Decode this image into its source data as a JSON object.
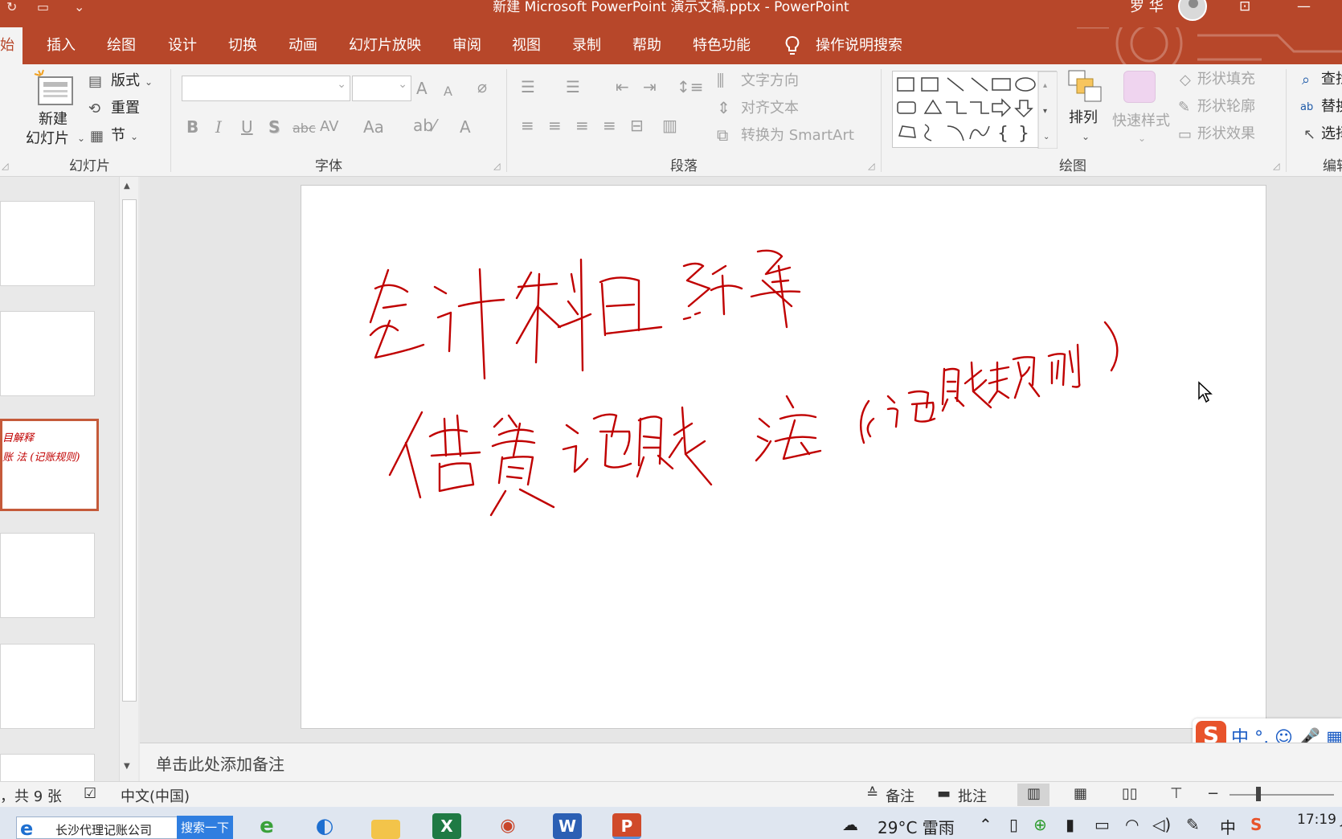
{
  "window": {
    "title": "新建 Microsoft PowerPoint 演示文稿.pptx  -  PowerPoint",
    "user": "罗 华"
  },
  "tabs": [
    "始",
    "插入",
    "绘图",
    "设计",
    "切换",
    "动画",
    "幻灯片放映",
    "审阅",
    "视图",
    "录制",
    "帮助",
    "特色功能",
    "操作说明搜索"
  ],
  "ribbon": {
    "slides_group": {
      "new_slide_line1": "新建",
      "new_slide_line2": "幻灯片",
      "layout": "版式",
      "reset": "重置",
      "section": "节",
      "label": "幻灯片"
    },
    "font_group": {
      "label": "字体",
      "bold": "B",
      "italic": "I",
      "underline": "U",
      "shadow": "S",
      "strike": "abc",
      "spacing": "AV",
      "case": "Aa",
      "color": "A",
      "grow": "A",
      "shrink": "A"
    },
    "paragraph_group": {
      "label": "段落",
      "text_direction": "文字方向",
      "align_text": "对齐文本",
      "smartart": "转换为 SmartArt"
    },
    "drawing_group": {
      "label": "绘图",
      "arrange": "排列",
      "quick_styles": "快速样式",
      "shape_fill": "形状填充",
      "shape_outline": "形状轮廓",
      "shape_effects": "形状效果"
    },
    "editing_group": {
      "label": "编辑",
      "find": "查找",
      "replace": "替换",
      "select": "选择"
    }
  },
  "thumb_text": {
    "line1": "目解释",
    "line2": "账 法 (记账规则)"
  },
  "notes_placeholder": "单击此处添加备注",
  "ink_text": {
    "line1": "会计科目解释",
    "line2": "借贷记账法（记账规则）"
  },
  "ime": {
    "logo": "S",
    "text": "中 °, ☺ 🎤 ▦"
  },
  "status": {
    "slide_count": "，共 9 张",
    "language": "中文(中国)",
    "notes": "备注",
    "comments": "批注"
  },
  "taskbar": {
    "search_text": "长沙代理记账公司",
    "search_button": "搜索一下",
    "weather": "29°C  雷雨",
    "ime_indicator": "中",
    "clock_time": "17:19 J"
  },
  "colors": {
    "accent": "#b7472a",
    "ink": "#c00000",
    "taskbar": "#dfe6f0"
  }
}
